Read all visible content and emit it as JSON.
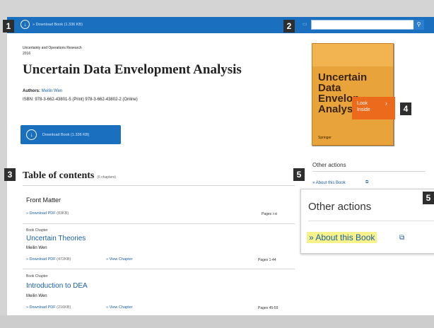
{
  "header": {
    "download_label": "» Download Book (1.336 KB)",
    "search_placeholder": ""
  },
  "markers": [
    "1",
    "2",
    "3",
    "4",
    "5",
    "5"
  ],
  "book": {
    "series": "Uncertainty and Operations Research",
    "year": "2016",
    "title": "Uncertain Data Envelopment Analysis",
    "authors_label": "Authors:",
    "author": "Meilin Wen",
    "isbn": "ISBN: 978-3-662-43801-5 (Print) 978-3-662-43802-2 (Online)",
    "download_button": "Download Book (1.336 KB)"
  },
  "cover": {
    "title_lines": [
      "Uncertain",
      "Data",
      "Envelop",
      "Analysis"
    ],
    "look_inside": [
      "Look",
      "Inside"
    ],
    "publisher": "Springer"
  },
  "toc": {
    "title": "Table of contents",
    "count": "(6 chapters)",
    "items": [
      {
        "type": "",
        "title": "Front Matter",
        "author": "",
        "pdf": "» Download PDF",
        "size": "(83KB)",
        "view": "",
        "pages": "Pages i-xi"
      },
      {
        "type": "Book Chapter",
        "title": "Uncertain Theories",
        "author": "Meilin Wen",
        "pdf": "» Download PDF",
        "size": "(472KB)",
        "view": "» View Chapter",
        "pages": "Pages 1-44"
      },
      {
        "type": "Book Chapter",
        "title": "Introduction to DEA",
        "author": "Meilin Wen",
        "pdf": "» Download PDF",
        "size": "(216KB)",
        "view": "» View Chapter",
        "pages": "Pages 45-59"
      }
    ]
  },
  "sidebar": {
    "other_actions": "Other actions",
    "about_link": "» About this Book"
  },
  "popup": {
    "title": "Other actions",
    "link": "» About this Book"
  }
}
